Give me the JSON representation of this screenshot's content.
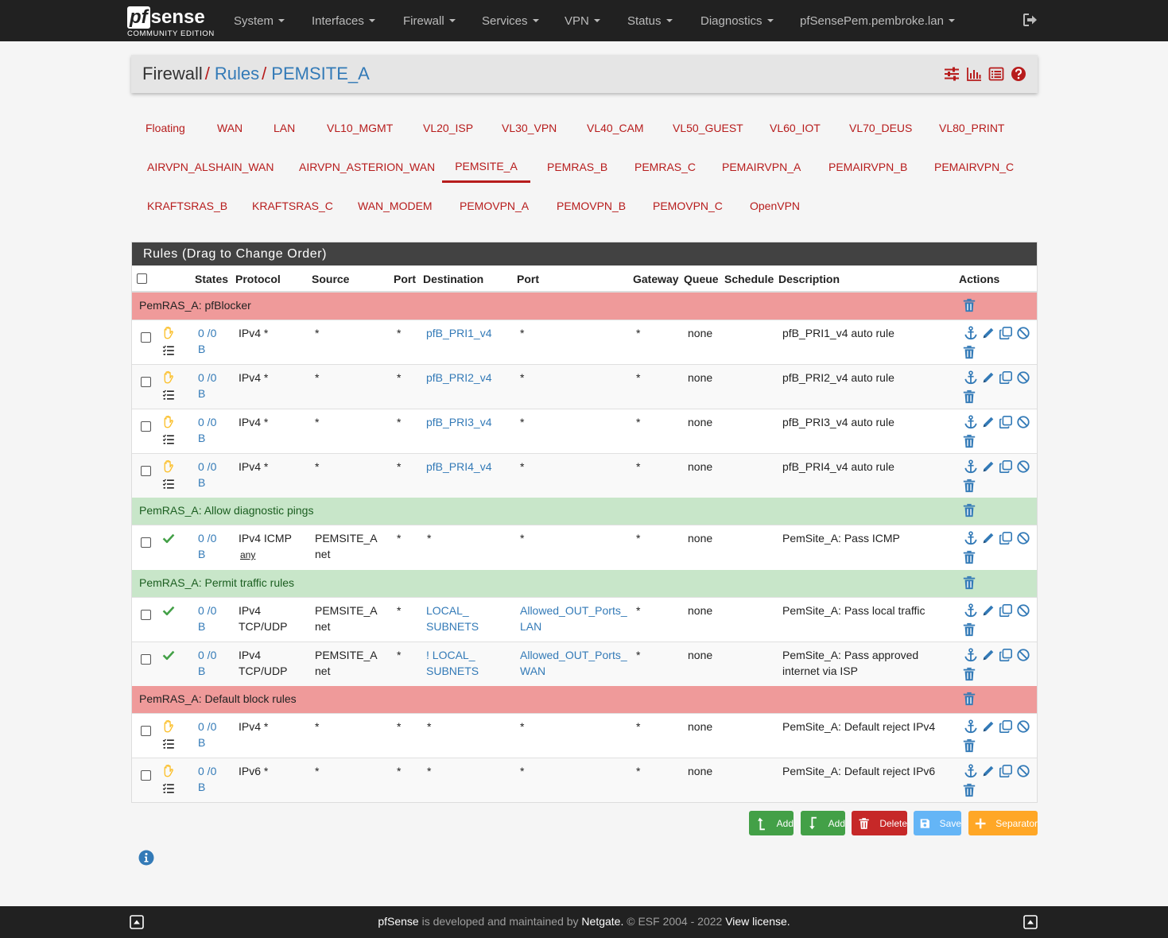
{
  "brand": {
    "logo_pf": "pf",
    "logo_sense": "sense",
    "edition": "COMMUNITY EDITION"
  },
  "nav": {
    "items": [
      {
        "label": "System"
      },
      {
        "label": "Interfaces"
      },
      {
        "label": "Firewall"
      },
      {
        "label": "Services"
      },
      {
        "label": "VPN"
      },
      {
        "label": "Status"
      },
      {
        "label": "Diagnostics"
      },
      {
        "label": "pfSensePem.pembroke.lan"
      }
    ],
    "logout_icon": "sign-out-icon"
  },
  "breadcrumb": {
    "items": [
      "Firewall",
      "Rules",
      "PEMSITE_A"
    ],
    "separator": "/",
    "icons": [
      "sliders-icon",
      "bar-chart-icon",
      "list-icon",
      "help-icon"
    ]
  },
  "tabs": {
    "row1": [
      "Floating",
      "WAN",
      "LAN",
      "VL10_MGMT",
      "VL20_ISP",
      "VL30_VPN",
      "VL40_CAM",
      "VL50_GUEST",
      "VL60_IOT",
      "VL70_DEUS",
      "VL80_PRINT"
    ],
    "row2": [
      "AIRVPN_ALSHAIN_WAN",
      "AIRVPN_ASTERION_WAN",
      "PEMSITE_A",
      "PEMRAS_B",
      "PEMRAS_C",
      "PEMAIRVPN_A",
      "PEMAIRVPN_B",
      "PEMAIRVPN_C"
    ],
    "row3": [
      "KRAFTSRAS_B",
      "KRAFTSRAS_C",
      "WAN_MODEM",
      "PEMOVPN_A",
      "PEMOVPN_B",
      "PEMOVPN_C",
      "OpenVPN"
    ],
    "active": "PEMSITE_A"
  },
  "rules": {
    "title": "Rules (Drag to Change Order)",
    "columns": {
      "states": "States",
      "protocol": "Protocol",
      "source": "Source",
      "port": "Port",
      "destination": "Destination",
      "dport": "Port",
      "gateway": "Gateway",
      "queue": "Queue",
      "schedule": "Schedule",
      "description": "Description",
      "actions": "Actions"
    },
    "separators": {
      "s0": "PemRAS_A: pfBlocker",
      "s1": "PemRAS_A: Allow diagnostic pings",
      "s2": "PemRAS_A: Permit traffic rules",
      "s3": "PemRAS_A: Default block rules"
    },
    "rows": [
      {
        "status": "block",
        "states1": "0 /0",
        "states2": "B",
        "proto1": "IPv4 *",
        "proto2": "",
        "src1": "*",
        "src2": "",
        "sport": "*",
        "dst1": "pfB_PRI1_v4",
        "dst2": "",
        "dport1": "*",
        "dport2": "",
        "gateway": "*",
        "queue": "none",
        "desc1": "pfB_PRI1_v4 auto rule",
        "desc2": ""
      },
      {
        "status": "block",
        "states1": "0 /0",
        "states2": "B",
        "proto1": "IPv4 *",
        "proto2": "",
        "src1": "*",
        "src2": "",
        "sport": "*",
        "dst1": "pfB_PRI2_v4",
        "dst2": "",
        "dport1": "*",
        "dport2": "",
        "gateway": "*",
        "queue": "none",
        "desc1": "pfB_PRI2_v4 auto rule",
        "desc2": ""
      },
      {
        "status": "block",
        "states1": "0 /0",
        "states2": "B",
        "proto1": "IPv4 *",
        "proto2": "",
        "src1": "*",
        "src2": "",
        "sport": "*",
        "dst1": "pfB_PRI3_v4",
        "dst2": "",
        "dport1": "*",
        "dport2": "",
        "gateway": "*",
        "queue": "none",
        "desc1": "pfB_PRI3_v4 auto rule",
        "desc2": ""
      },
      {
        "status": "block",
        "states1": "0 /0",
        "states2": "B",
        "proto1": "IPv4 *",
        "proto2": "",
        "src1": "*",
        "src2": "",
        "sport": "*",
        "dst1": "pfB_PRI4_v4",
        "dst2": "",
        "dport1": "*",
        "dport2": "",
        "gateway": "*",
        "queue": "none",
        "desc1": "pfB_PRI4_v4 auto rule",
        "desc2": ""
      },
      {
        "status": "pass",
        "states1": "0 /0",
        "states2": "B",
        "proto1": "IPv4 ICMP",
        "proto2": "any",
        "src1": "PEMSITE_A",
        "src2": "net",
        "sport": "*",
        "dst1": "*",
        "dst2": "",
        "dport1": "*",
        "dport2": "",
        "gateway": "*",
        "queue": "none",
        "desc1": "PemSite_A: Pass ICMP",
        "desc2": ""
      },
      {
        "status": "pass",
        "states1": "0 /0",
        "states2": "B",
        "proto1": "IPv4",
        "proto2": "TCP/UDP",
        "src1": "PEMSITE_A",
        "src2": "net",
        "sport": "*",
        "dst1": "LOCAL_",
        "dst2": "SUBNETS",
        "dport1": "Allowed_OUT_Ports_",
        "dport2": "LAN",
        "gateway": "*",
        "queue": "none",
        "desc1": "PemSite_A: Pass local traffic",
        "desc2": ""
      },
      {
        "status": "pass",
        "states1": "0 /0",
        "states2": "B",
        "proto1": "IPv4",
        "proto2": "TCP/UDP",
        "src1": "PEMSITE_A",
        "src2": "net",
        "sport": "*",
        "dst1": "! LOCAL_",
        "dst2": "SUBNETS",
        "dport1": "Allowed_OUT_Ports_",
        "dport2": "WAN",
        "gateway": "*",
        "queue": "none",
        "desc1": "PemSite_A: Pass approved",
        "desc2": "internet via ISP"
      },
      {
        "status": "block",
        "states1": "0 /0",
        "states2": "B",
        "proto1": "IPv4 *",
        "proto2": "",
        "src1": "*",
        "src2": "",
        "sport": "*",
        "dst1": "*",
        "dst2": "",
        "dport1": "*",
        "dport2": "",
        "gateway": "*",
        "queue": "none",
        "desc1": "PemSite_A: Default reject IPv4",
        "desc2": ""
      },
      {
        "status": "block",
        "states1": "0 /0",
        "states2": "B",
        "proto1": "IPv6 *",
        "proto2": "",
        "src1": "*",
        "src2": "",
        "sport": "*",
        "dst1": "*",
        "dst2": "",
        "dport1": "*",
        "dport2": "",
        "gateway": "*",
        "queue": "none",
        "desc1": "PemSite_A: Default reject IPv6",
        "desc2": ""
      }
    ]
  },
  "buttons": {
    "add_top": "Add",
    "add_bottom": "Add",
    "delete": "Delete",
    "save": "Save",
    "separator": "Separator"
  },
  "footer": {
    "product": "pfSense",
    "middle": " is developed and maintained by ",
    "company": "Netgate.",
    "copyright": " © ESF 2004 - 2022 ",
    "license": "View license."
  },
  "colors": {
    "navbar": "#212121",
    "accent_red": "#b71c1c",
    "link_blue": "#337ab7",
    "block_separator": "#ef9a9a",
    "pass_separator": "#c8e6c9",
    "pass_check": "#43a047",
    "block_hand": "#fbc02d"
  }
}
